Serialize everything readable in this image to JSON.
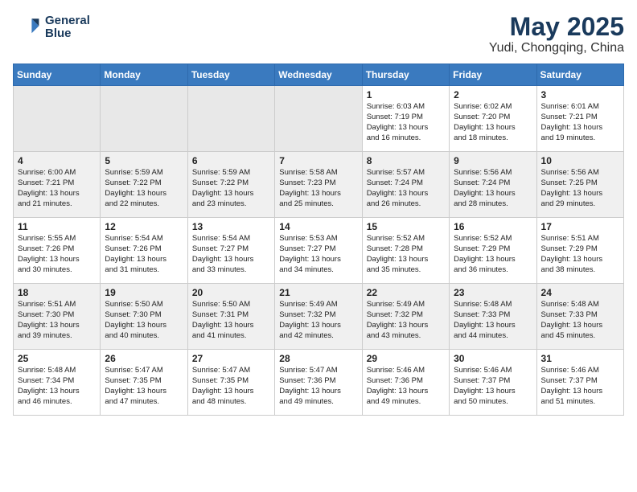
{
  "header": {
    "logo_line1": "General",
    "logo_line2": "Blue",
    "title": "May 2025",
    "subtitle": "Yudi, Chongqing, China"
  },
  "weekdays": [
    "Sunday",
    "Monday",
    "Tuesday",
    "Wednesday",
    "Thursday",
    "Friday",
    "Saturday"
  ],
  "weeks": [
    [
      {
        "day": "",
        "detail": ""
      },
      {
        "day": "",
        "detail": ""
      },
      {
        "day": "",
        "detail": ""
      },
      {
        "day": "",
        "detail": ""
      },
      {
        "day": "1",
        "detail": "Sunrise: 6:03 AM\nSunset: 7:19 PM\nDaylight: 13 hours\nand 16 minutes."
      },
      {
        "day": "2",
        "detail": "Sunrise: 6:02 AM\nSunset: 7:20 PM\nDaylight: 13 hours\nand 18 minutes."
      },
      {
        "day": "3",
        "detail": "Sunrise: 6:01 AM\nSunset: 7:21 PM\nDaylight: 13 hours\nand 19 minutes."
      }
    ],
    [
      {
        "day": "4",
        "detail": "Sunrise: 6:00 AM\nSunset: 7:21 PM\nDaylight: 13 hours\nand 21 minutes."
      },
      {
        "day": "5",
        "detail": "Sunrise: 5:59 AM\nSunset: 7:22 PM\nDaylight: 13 hours\nand 22 minutes."
      },
      {
        "day": "6",
        "detail": "Sunrise: 5:59 AM\nSunset: 7:22 PM\nDaylight: 13 hours\nand 23 minutes."
      },
      {
        "day": "7",
        "detail": "Sunrise: 5:58 AM\nSunset: 7:23 PM\nDaylight: 13 hours\nand 25 minutes."
      },
      {
        "day": "8",
        "detail": "Sunrise: 5:57 AM\nSunset: 7:24 PM\nDaylight: 13 hours\nand 26 minutes."
      },
      {
        "day": "9",
        "detail": "Sunrise: 5:56 AM\nSunset: 7:24 PM\nDaylight: 13 hours\nand 28 minutes."
      },
      {
        "day": "10",
        "detail": "Sunrise: 5:56 AM\nSunset: 7:25 PM\nDaylight: 13 hours\nand 29 minutes."
      }
    ],
    [
      {
        "day": "11",
        "detail": "Sunrise: 5:55 AM\nSunset: 7:26 PM\nDaylight: 13 hours\nand 30 minutes."
      },
      {
        "day": "12",
        "detail": "Sunrise: 5:54 AM\nSunset: 7:26 PM\nDaylight: 13 hours\nand 31 minutes."
      },
      {
        "day": "13",
        "detail": "Sunrise: 5:54 AM\nSunset: 7:27 PM\nDaylight: 13 hours\nand 33 minutes."
      },
      {
        "day": "14",
        "detail": "Sunrise: 5:53 AM\nSunset: 7:27 PM\nDaylight: 13 hours\nand 34 minutes."
      },
      {
        "day": "15",
        "detail": "Sunrise: 5:52 AM\nSunset: 7:28 PM\nDaylight: 13 hours\nand 35 minutes."
      },
      {
        "day": "16",
        "detail": "Sunrise: 5:52 AM\nSunset: 7:29 PM\nDaylight: 13 hours\nand 36 minutes."
      },
      {
        "day": "17",
        "detail": "Sunrise: 5:51 AM\nSunset: 7:29 PM\nDaylight: 13 hours\nand 38 minutes."
      }
    ],
    [
      {
        "day": "18",
        "detail": "Sunrise: 5:51 AM\nSunset: 7:30 PM\nDaylight: 13 hours\nand 39 minutes."
      },
      {
        "day": "19",
        "detail": "Sunrise: 5:50 AM\nSunset: 7:30 PM\nDaylight: 13 hours\nand 40 minutes."
      },
      {
        "day": "20",
        "detail": "Sunrise: 5:50 AM\nSunset: 7:31 PM\nDaylight: 13 hours\nand 41 minutes."
      },
      {
        "day": "21",
        "detail": "Sunrise: 5:49 AM\nSunset: 7:32 PM\nDaylight: 13 hours\nand 42 minutes."
      },
      {
        "day": "22",
        "detail": "Sunrise: 5:49 AM\nSunset: 7:32 PM\nDaylight: 13 hours\nand 43 minutes."
      },
      {
        "day": "23",
        "detail": "Sunrise: 5:48 AM\nSunset: 7:33 PM\nDaylight: 13 hours\nand 44 minutes."
      },
      {
        "day": "24",
        "detail": "Sunrise: 5:48 AM\nSunset: 7:33 PM\nDaylight: 13 hours\nand 45 minutes."
      }
    ],
    [
      {
        "day": "25",
        "detail": "Sunrise: 5:48 AM\nSunset: 7:34 PM\nDaylight: 13 hours\nand 46 minutes."
      },
      {
        "day": "26",
        "detail": "Sunrise: 5:47 AM\nSunset: 7:35 PM\nDaylight: 13 hours\nand 47 minutes."
      },
      {
        "day": "27",
        "detail": "Sunrise: 5:47 AM\nSunset: 7:35 PM\nDaylight: 13 hours\nand 48 minutes."
      },
      {
        "day": "28",
        "detail": "Sunrise: 5:47 AM\nSunset: 7:36 PM\nDaylight: 13 hours\nand 49 minutes."
      },
      {
        "day": "29",
        "detail": "Sunrise: 5:46 AM\nSunset: 7:36 PM\nDaylight: 13 hours\nand 49 minutes."
      },
      {
        "day": "30",
        "detail": "Sunrise: 5:46 AM\nSunset: 7:37 PM\nDaylight: 13 hours\nand 50 minutes."
      },
      {
        "day": "31",
        "detail": "Sunrise: 5:46 AM\nSunset: 7:37 PM\nDaylight: 13 hours\nand 51 minutes."
      }
    ]
  ]
}
